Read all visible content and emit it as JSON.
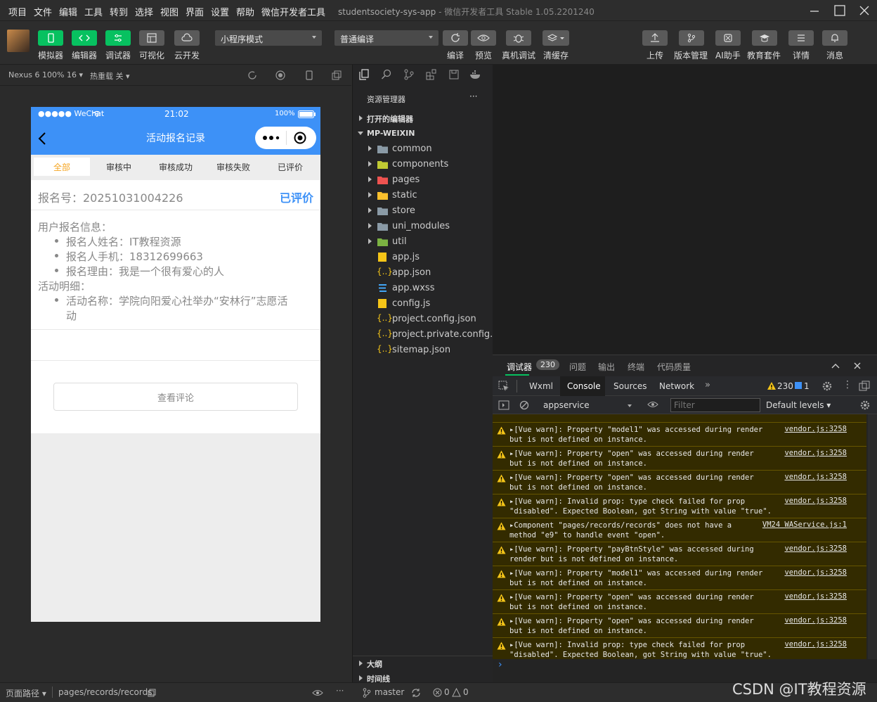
{
  "menu": [
    "项目",
    "文件",
    "编辑",
    "工具",
    "转到",
    "选择",
    "视图",
    "界面",
    "设置",
    "帮助",
    "微信开发者工具"
  ],
  "window": {
    "title": "studentsociety-sys-app",
    "subtitle": "- 微信开发者工具 Stable 1.05.2201240"
  },
  "toolbar": {
    "left_buttons": [
      "模拟器",
      "编辑器",
      "调试器",
      "可视化",
      "云开发"
    ],
    "mode_select": "小程序模式",
    "compile_select": "普通编译",
    "mid_buttons": [
      "编译",
      "预览",
      "真机调试",
      "清缓存"
    ],
    "right_buttons": [
      "上传",
      "版本管理",
      "AI助手",
      "教育套件",
      "详情",
      "消息"
    ]
  },
  "simulator": {
    "device": "Nexus 6 100% 16",
    "hotreload": "热重载 关",
    "status": {
      "carrier": "●●●●● WeChat",
      "time": "21:02",
      "battery": "100%"
    },
    "nav_title": "活动报名记录",
    "tabs": [
      "全部",
      "审核中",
      "审核成功",
      "审核失败",
      "已评价"
    ],
    "record": {
      "reg_no": "报名号：20251031004226",
      "status": "已评价",
      "user_info_title": "用户报名信息：",
      "user_info": [
        "报名人姓名：IT教程资源",
        "报名人手机：18312699663",
        "报名理由：我是一个很有爱心的人"
      ],
      "activity_title": "活动明细：",
      "activity_line1": "活动名称：学院向阳爱心社举办“安林行”志愿活",
      "activity_line2": "动"
    },
    "review_button": "查看评论"
  },
  "explorer": {
    "title": "资源管理器",
    "more": "···",
    "open_editors": "打开的编辑器",
    "project": "MP-WEIXIN",
    "folders": [
      "common",
      "components",
      "pages",
      "static",
      "store",
      "uni_modules",
      "util"
    ],
    "files": [
      "app.js",
      "app.json",
      "app.wxss",
      "config.js",
      "project.config.json",
      "project.private.config.js...",
      "sitemap.json"
    ],
    "outline": "大纲",
    "timeline": "时间线"
  },
  "devtools": {
    "tabs": [
      "调试器",
      "问题",
      "输出",
      "终端",
      "代码质量"
    ],
    "debugger_count": "230",
    "subtabs": [
      "Wxml",
      "Console",
      "Sources",
      "Network"
    ],
    "warn_count": "230",
    "info_count": "1",
    "context": "appservice",
    "filter_placeholder": "Filter",
    "levels": "Default levels",
    "messages": [
      {
        "text": "▸[Vue warn]: Property \"model1\" was accessed during render\nbut is not defined on instance.",
        "src": "vendor.js:3258"
      },
      {
        "text": "▸[Vue warn]: Property \"open\" was accessed during render\nbut is not defined on instance.",
        "src": "vendor.js:3258"
      },
      {
        "text": "▸[Vue warn]: Property \"open\" was accessed during render\nbut is not defined on instance.",
        "src": "vendor.js:3258"
      },
      {
        "text": "▸[Vue warn]: Invalid prop: type check failed for prop\n\"disabled\". Expected Boolean, got String with value \"true\".",
        "src": "vendor.js:3258"
      },
      {
        "text": "▸Component \"pages/records/records\" does not have a\nmethod \"e9\" to handle event \"open\".",
        "src": "VM24 WAService.js:1"
      },
      {
        "text": "▸[Vue warn]: Property \"payBtnStyle\" was accessed during\nrender but is not defined on instance.",
        "src": "vendor.js:3258"
      },
      {
        "text": "▸[Vue warn]: Property \"model1\" was accessed during render\nbut is not defined on instance.",
        "src": "vendor.js:3258"
      },
      {
        "text": "▸[Vue warn]: Property \"open\" was accessed during render\nbut is not defined on instance.",
        "src": "vendor.js:3258"
      },
      {
        "text": "▸[Vue warn]: Property \"open\" was accessed during render\nbut is not defined on instance.",
        "src": "vendor.js:3258"
      },
      {
        "text": "▸[Vue warn]: Invalid prop: type check failed for prop\n\"disabled\". Expected Boolean, got String with value \"true\".",
        "src": "vendor.js:3258"
      }
    ],
    "prompt": "›"
  },
  "statusbar": {
    "page_path_label": "页面路径",
    "page_path": "pages/records/records",
    "branch": "master",
    "errors": "0",
    "warnings": "0"
  },
  "watermark": "CSDN @IT教程资源",
  "colors": {
    "accent_green": "#07c160",
    "nav_blue": "#3d91f7",
    "tab_active": "#f5a623",
    "warn_bg": "#332b00"
  }
}
